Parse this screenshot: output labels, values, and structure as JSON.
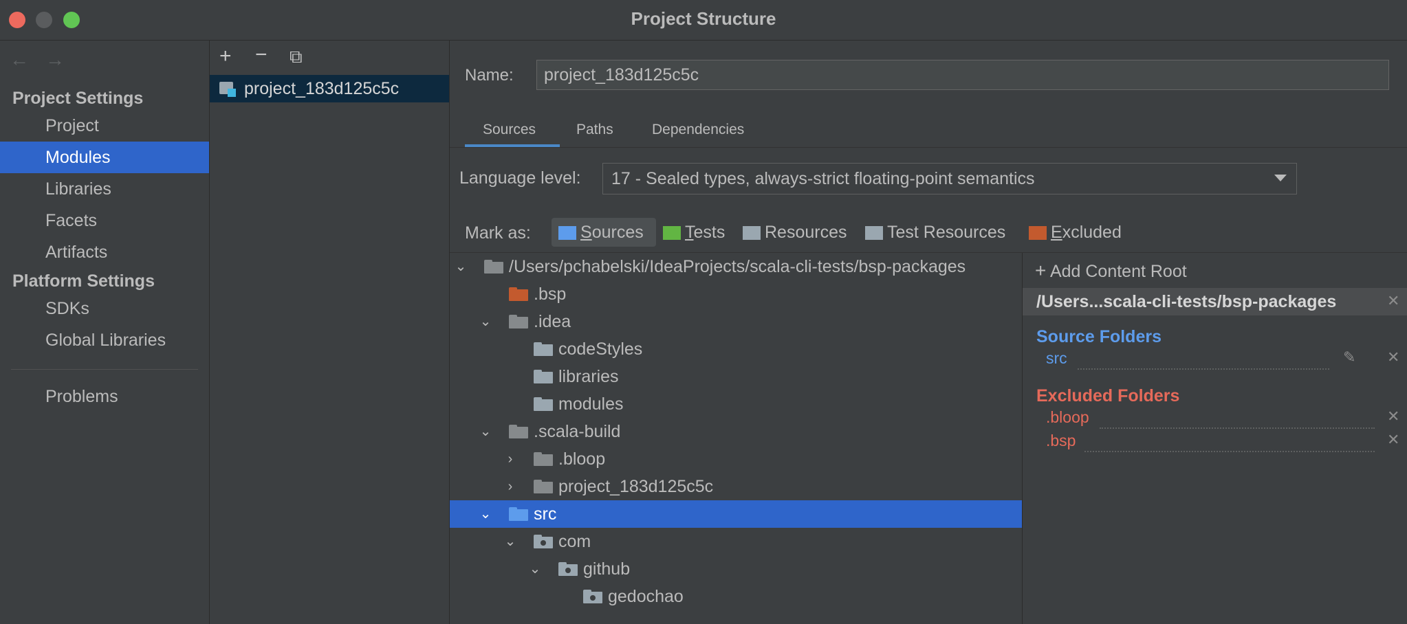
{
  "window": {
    "title": "Project Structure"
  },
  "colors": {
    "accent": "#2f65ca",
    "source": "#5d9cec",
    "excluded": "#e66a5a",
    "test": "#62b543",
    "resources_icon": "#9aa7b0",
    "excluded_folder": "#c35a2e"
  },
  "sidebar": {
    "back": "←",
    "forward": "→",
    "project_settings_header": "Project Settings",
    "project_items": [
      "Project",
      "Modules",
      "Libraries",
      "Facets",
      "Artifacts"
    ],
    "platform_settings_header": "Platform Settings",
    "platform_items": [
      "SDKs",
      "Global Libraries"
    ],
    "problems": "Problems",
    "selected": "Modules"
  },
  "module_list": {
    "add": "+",
    "remove": "−",
    "copy": "⧉",
    "items": [
      "project_183d125c5c"
    ]
  },
  "main": {
    "name_label": "Name:",
    "name_value": "project_183d125c5c",
    "tabs": [
      "Sources",
      "Paths",
      "Dependencies"
    ],
    "active_tab": "Sources",
    "language_level_label": "Language level:",
    "language_level_value": "17 - Sealed types, always-strict floating-point semantics",
    "mark_as_label": "Mark as:",
    "mark_as_buttons": [
      {
        "label": "Sources",
        "mnemonic": "S",
        "rest": "ources",
        "icon": "sources-folder-icon"
      },
      {
        "label": "Tests",
        "mnemonic": "T",
        "rest": "ests",
        "icon": "tests-folder-icon"
      },
      {
        "label": "Resources",
        "icon": "resources-folder-icon"
      },
      {
        "label": "Test Resources",
        "icon": "test-resources-folder-icon"
      },
      {
        "label": "Excluded",
        "mnemonic": "E",
        "rest": "xcluded",
        "icon": "excluded-folder-icon"
      }
    ]
  },
  "tree": [
    {
      "label": "/Users/pchabelski/IdeaProjects/scala-cli-tests/bsp-packages",
      "expanded": true
    },
    {
      "label": ".bsp"
    },
    {
      "label": ".idea",
      "expanded": true
    },
    {
      "label": "codeStyles"
    },
    {
      "label": "libraries"
    },
    {
      "label": "modules"
    },
    {
      "label": ".scala-build",
      "expanded": true
    },
    {
      "label": ".bloop",
      "expanded": false
    },
    {
      "label": "project_183d125c5c",
      "expanded": false
    },
    {
      "label": "src",
      "expanded": true,
      "selected": true
    },
    {
      "label": "com",
      "expanded": true
    },
    {
      "label": "github",
      "expanded": true
    },
    {
      "label": "gedochao"
    }
  ],
  "content_root": {
    "add_label": "Add Content Root",
    "add_mnemonic": "C",
    "path": "/Users...scala-cli-tests/bsp-packages",
    "source_folders_title": "Source Folders",
    "source_folders": [
      "src"
    ],
    "excluded_folders_title": "Excluded Folders",
    "excluded_folders": [
      ".bloop",
      ".bsp"
    ]
  }
}
